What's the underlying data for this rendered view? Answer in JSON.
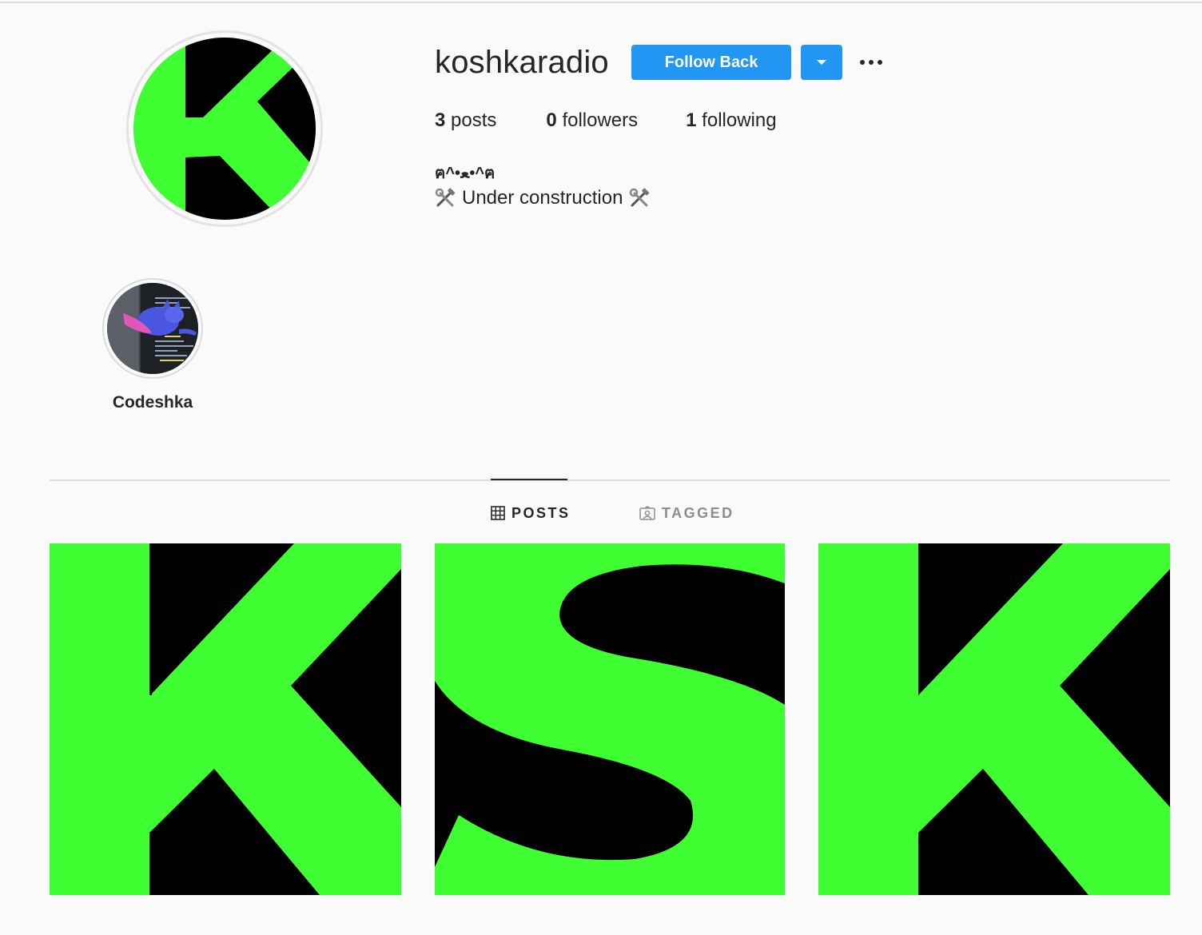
{
  "profile": {
    "username": "koshkaradio",
    "follow_label": "Follow Back",
    "stats": {
      "posts_count": "3",
      "posts_label": "posts",
      "followers_count": "0",
      "followers_label": "followers",
      "following_count": "1",
      "following_label": "following"
    },
    "bio": {
      "line1": "ฅ^•ﻌ•^ฅ",
      "line2": "Under construction"
    }
  },
  "highlights": [
    {
      "label": "Codeshka"
    }
  ],
  "tabs": {
    "posts": "POSTS",
    "tagged": "TAGGED",
    "active": "posts"
  },
  "posts": [
    {
      "letter": "K"
    },
    {
      "letter": "S"
    },
    {
      "letter": "K"
    }
  ],
  "colors": {
    "accent_blue": "#2196f3",
    "brand_green": "#3ffe32",
    "brand_black": "#000000",
    "text": "#262626",
    "muted": "#8e8e8e",
    "background": "#fafafa"
  },
  "icons": {
    "more": "more-options-icon",
    "dropdown": "chevron-down-icon",
    "posts_tab": "grid-icon",
    "tagged_tab": "tagged-user-icon",
    "bio": "hammer-and-wrench-icon"
  }
}
